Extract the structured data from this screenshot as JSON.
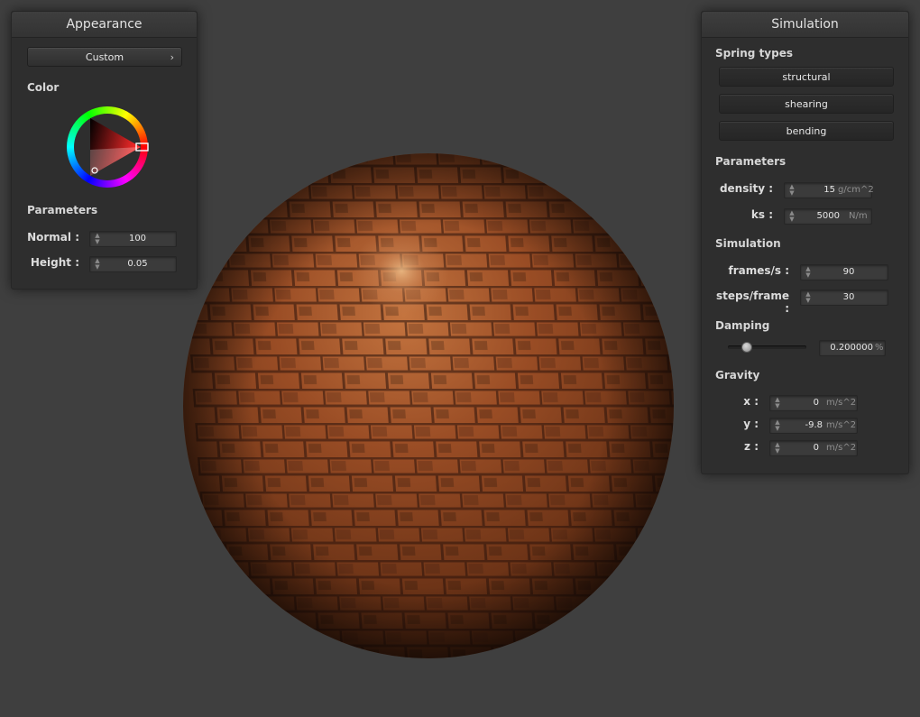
{
  "appearance": {
    "title": "Appearance",
    "preset": {
      "label": "Custom",
      "chevron": "›"
    },
    "color_label": "Color",
    "color_picker": {
      "icon": "color-wheel-icon",
      "selected_hue_color": "#ff2a2a"
    },
    "parameters_label": "Parameters",
    "normal": {
      "label": "Normal :",
      "value": "100"
    },
    "height": {
      "label": "Height :",
      "value": "0.05"
    }
  },
  "simulation": {
    "title": "Simulation",
    "spring_types_label": "Spring types",
    "spring_types": [
      "structural",
      "shearing",
      "bending"
    ],
    "parameters_label": "Parameters",
    "density": {
      "label": "density :",
      "value": "15",
      "unit": "g/cm^2"
    },
    "ks": {
      "label": "ks :",
      "value": "5000",
      "unit": "N/m"
    },
    "simulation_label": "Simulation",
    "frames_per_s": {
      "label": "frames/s :",
      "value": "90"
    },
    "steps_per_frame": {
      "label": "steps/frame :",
      "value": "30"
    },
    "damping_label": "Damping",
    "damping": {
      "value": "0.200000",
      "unit": "%",
      "slider_fraction": 0.2
    },
    "gravity_label": "Gravity",
    "gravity": {
      "x": {
        "label": "x :",
        "value": "0",
        "unit": "m/s^2"
      },
      "y": {
        "label": "y :",
        "value": "-9.8",
        "unit": "m/s^2"
      },
      "z": {
        "label": "z :",
        "value": "0",
        "unit": "m/s^2"
      }
    }
  },
  "colors": {
    "background": "#3f3f3f",
    "panel": "#2e2e2e",
    "material_base": "#8a4423",
    "material_highlight": "#d08a5a"
  },
  "icons": {
    "spinner_up": "▲",
    "spinner_down": "▼"
  }
}
